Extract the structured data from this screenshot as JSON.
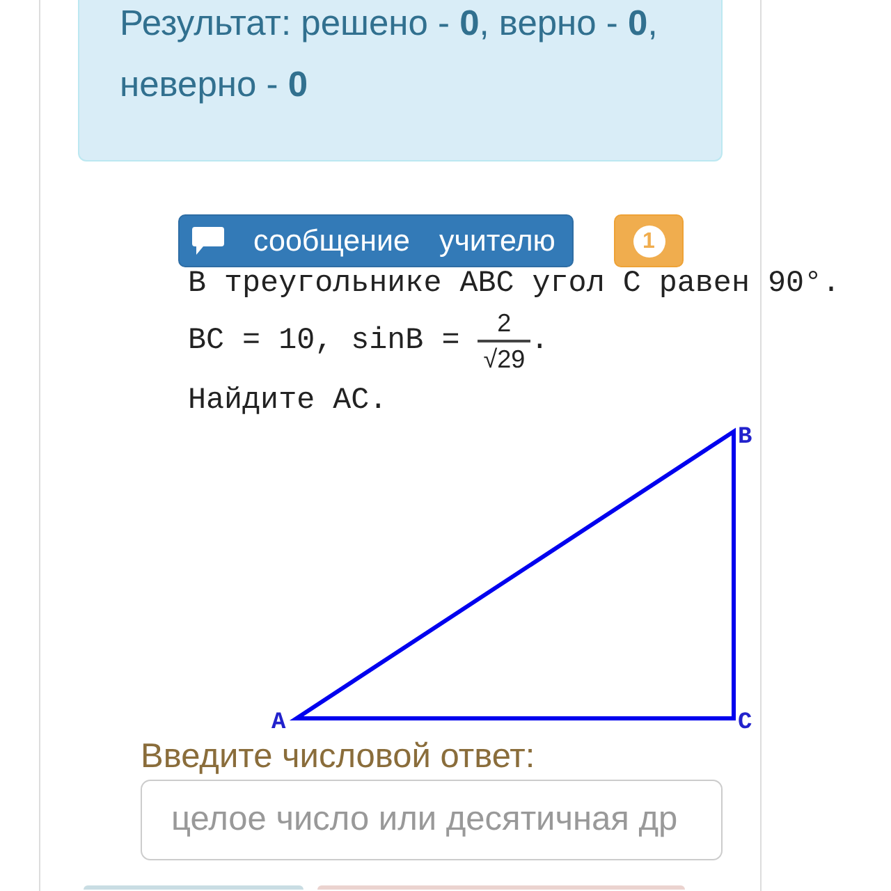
{
  "result": {
    "text": "Результат: решено - **0**, верно - **0**, неверно - **0**"
  },
  "message_button": {
    "label": "сообщение учителю"
  },
  "notification": {
    "count": "1"
  },
  "problem": {
    "line_1": "В треугольнике ABC угол C равен 90°.",
    "line_2": {
      "text": "BC = 10, sinB =",
      "numerator": "2",
      "denominator": "√29",
      "end": "."
    },
    "line_3": "Найдите AC."
  },
  "figure": {
    "vertices": [
      "A",
      "B",
      "C"
    ]
  },
  "answer": {
    "label": "Введите числовой ответ:",
    "placeholder": "целое число или десятичная др"
  }
}
